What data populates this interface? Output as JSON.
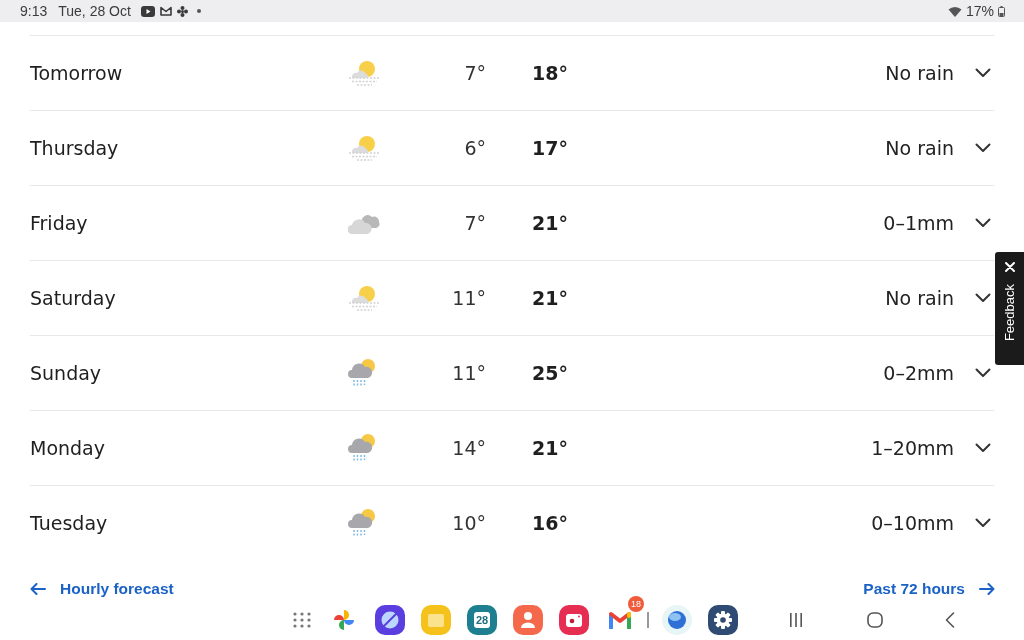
{
  "status_bar": {
    "time": "9:13",
    "date": "Tue, 28 Oct",
    "battery": "17%"
  },
  "forecast": {
    "days": [
      {
        "day": "Tomorrow",
        "kind": "haze",
        "low": "7°",
        "high": "18°",
        "rain": "No rain",
        "expanded": false
      },
      {
        "day": "Thursday",
        "kind": "haze",
        "low": "6°",
        "high": "17°",
        "rain": "No rain",
        "expanded": false
      },
      {
        "day": "Friday",
        "kind": "cloudy",
        "low": "7°",
        "high": "21°",
        "rain": "0–1mm",
        "expanded": false
      },
      {
        "day": "Saturday",
        "kind": "haze",
        "low": "11°",
        "high": "21°",
        "rain": "No rain",
        "expanded": false
      },
      {
        "day": "Sunday",
        "kind": "showers",
        "low": "11°",
        "high": "25°",
        "rain": "0–2mm",
        "expanded": false
      },
      {
        "day": "Monday",
        "kind": "showers",
        "low": "14°",
        "high": "21°",
        "rain": "1–20mm",
        "expanded": false
      },
      {
        "day": "Tuesday",
        "kind": "showers",
        "low": "10°",
        "high": "16°",
        "rain": "0–10mm",
        "expanded": false
      }
    ]
  },
  "links": [
    {
      "label": "Hourly forecast",
      "kind": "back"
    },
    {
      "label": "Past 72 hours",
      "kind": "forward"
    }
  ],
  "feedback_tab": {
    "label": "Feedback"
  },
  "dock": {
    "calendar_day": "28",
    "mail_badge": "18"
  }
}
